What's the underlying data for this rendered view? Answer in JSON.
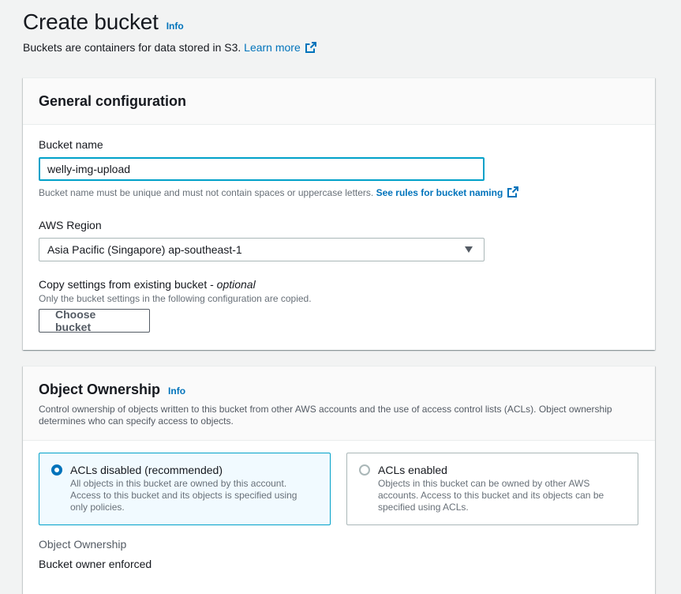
{
  "page": {
    "title": "Create bucket",
    "info_label": "Info",
    "description": "Buckets are containers for data stored in S3.",
    "learn_more": "Learn more"
  },
  "general": {
    "title": "General configuration",
    "bucket_name_label": "Bucket name",
    "bucket_name_value": "welly-img-upload",
    "bucket_name_hint": "Bucket name must be unique and must not contain spaces or uppercase letters.",
    "rules_link": "See rules for bucket naming",
    "region_label": "AWS Region",
    "region_value": "Asia Pacific (Singapore) ap-southeast-1",
    "copy_label": "Copy settings from existing bucket - ",
    "copy_optional": "optional",
    "copy_hint": "Only the bucket settings in the following configuration are copied.",
    "choose_button": "Choose bucket"
  },
  "ownership": {
    "title": "Object Ownership",
    "info_label": "Info",
    "description": "Control ownership of objects written to this bucket from other AWS accounts and the use of access control lists (ACLs). Object ownership determines who can specify access to objects.",
    "options": [
      {
        "label": "ACLs disabled (recommended)",
        "description": "All objects in this bucket are owned by this account. Access to this bucket and its objects is specified using only policies.",
        "selected": true
      },
      {
        "label": "ACLs enabled",
        "description": "Objects in this bucket can be owned by other AWS accounts. Access to this bucket and its objects can be specified using ACLs.",
        "selected": false
      }
    ],
    "result_label": "Object Ownership",
    "result_value": "Bucket owner enforced"
  },
  "colors": {
    "link": "#0073bb",
    "focus": "#00a1c9",
    "selected_bg": "#f1faff"
  }
}
